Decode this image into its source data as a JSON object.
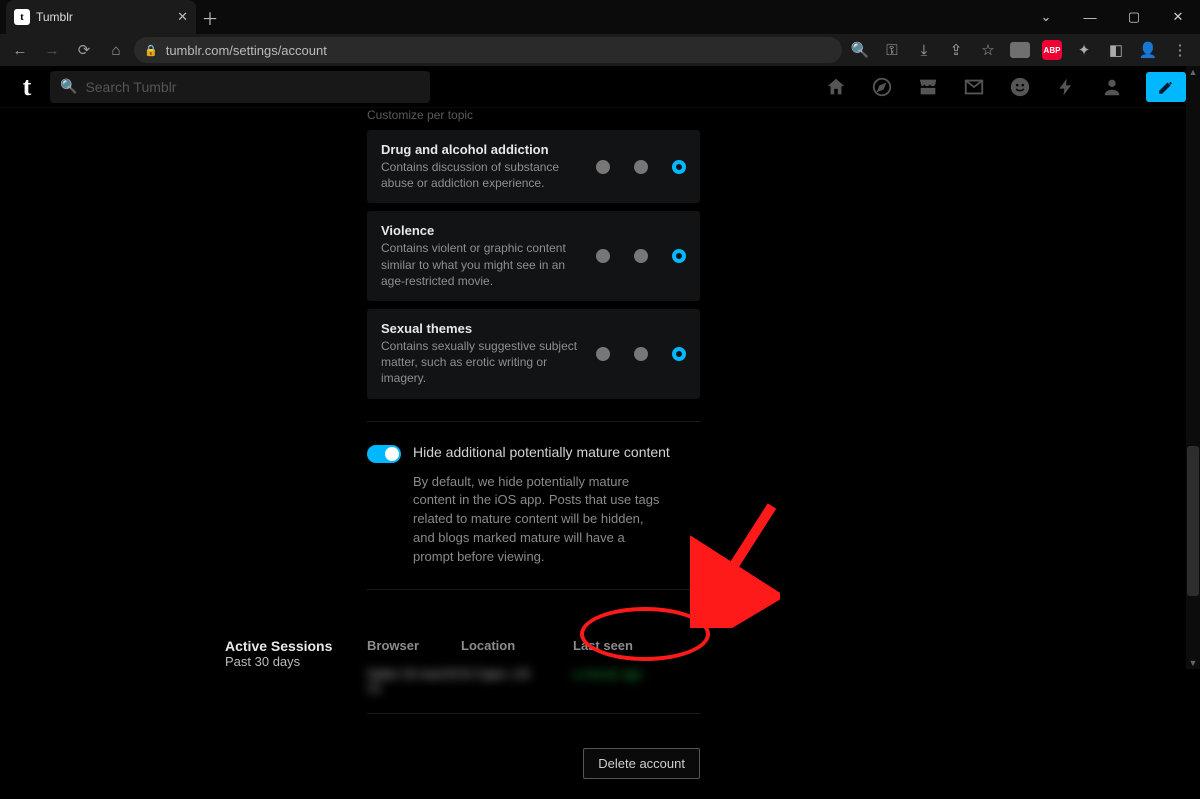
{
  "browser": {
    "tab_title": "Tumblr",
    "url": "tumblr.com/settings/account"
  },
  "search": {
    "placeholder": "Search Tumblr"
  },
  "cutoff": "Customize per topic",
  "topics": [
    {
      "title": "Drug and alcohol addiction",
      "desc": "Contains discussion of substance abuse or addiction experience."
    },
    {
      "title": "Violence",
      "desc": "Contains violent or graphic content similar to what you might see in an age-restricted movie."
    },
    {
      "title": "Sexual themes",
      "desc": "Contains sexually suggestive subject matter, such as erotic writing or imagery."
    }
  ],
  "hide_toggle": {
    "label": "Hide additional potentially mature content",
    "desc": "By default, we hide potentially mature content in the iOS app. Posts that use tags related to mature content will be hidden, and blogs marked mature will have a prompt before viewing."
  },
  "sessions": {
    "heading": "Active Sessions",
    "subheading": "Past 30 days",
    "columns": {
      "browser": "Browser",
      "location": "Location",
      "last_seen": "Last seen"
    },
    "row": {
      "browser": "Safari 16 macOS 13",
      "location": "El Cajon, US",
      "last_seen": "a minute ago"
    }
  },
  "delete_label": "Delete account"
}
